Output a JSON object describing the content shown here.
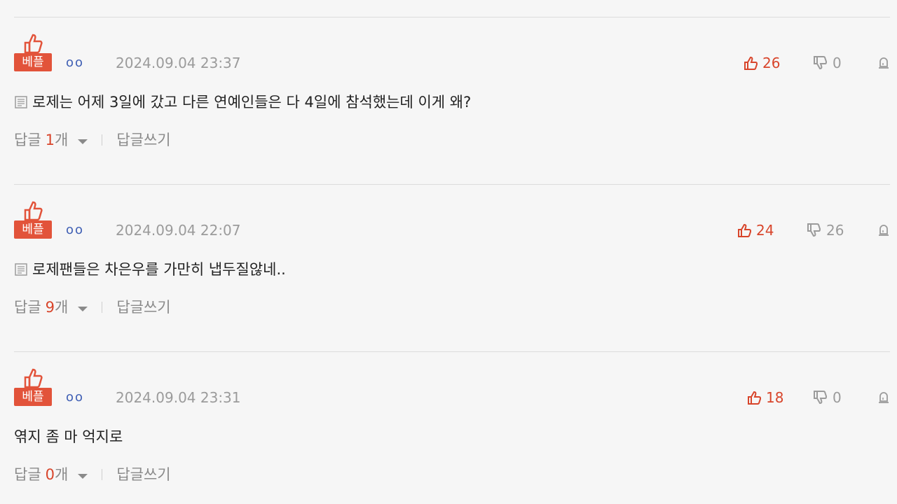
{
  "best_label": "베플",
  "reply_label": "답글",
  "reply_unit": "개",
  "write_reply_label": "답글쓰기",
  "colors": {
    "accent": "#e2533a",
    "like": "#d8452b",
    "muted": "#9b9b9b",
    "author": "#3f5fb4"
  },
  "comments": [
    {
      "author": "oo",
      "date": "2024.09.04 23:37",
      "likes": "26",
      "dislikes": "0",
      "text": "로제는 어제 3일에 갔고 다른 연예인들은 다 4일에 참석했는데 이게 왜?",
      "has_doc_icon": true,
      "reply_count": "1"
    },
    {
      "author": "oo",
      "date": "2024.09.04 22:07",
      "likes": "24",
      "dislikes": "26",
      "text": "로제팬들은 차은우를 가만히 냅두질않네..",
      "has_doc_icon": true,
      "reply_count": "9"
    },
    {
      "author": "oo",
      "date": "2024.09.04 23:31",
      "likes": "18",
      "dislikes": "0",
      "text": "엮지 좀 마 억지로",
      "has_doc_icon": false,
      "reply_count": "0"
    }
  ]
}
